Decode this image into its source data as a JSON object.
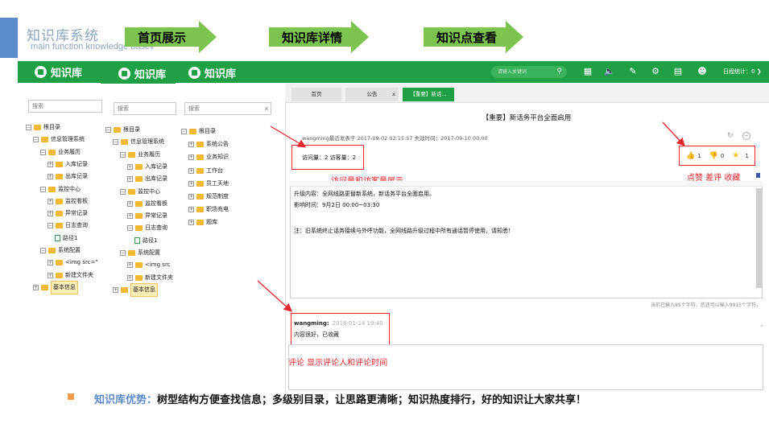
{
  "slide": {
    "title": "知识库系统",
    "subtitle": "main function knowledge basev",
    "steps": [
      "首页展示",
      "知识库详情",
      "知识点查看"
    ]
  },
  "app": {
    "logo_text": "知识库",
    "search_placeholder": "请输入关键词",
    "schedule": "日程统计：0",
    "icons": [
      "grid-icon",
      "speaker-icon",
      "edit-icon",
      "gear-icon",
      "document-icon",
      "user-icon"
    ]
  },
  "trees": [
    {
      "search_placeholder": "搜索",
      "items": [
        {
          "label": "根目录",
          "pm": "−",
          "type": "folder",
          "level": 0
        },
        {
          "label": "信息管理系统",
          "pm": "−",
          "type": "folder",
          "level": 1
        },
        {
          "label": "业务履历",
          "pm": "−",
          "type": "folder",
          "level": 2
        },
        {
          "label": "入库记录",
          "pm": "+",
          "type": "folder",
          "level": 3
        },
        {
          "label": "出库记录",
          "pm": "+",
          "type": "folder",
          "level": 3
        },
        {
          "label": "监控中心",
          "pm": "−",
          "type": "folder",
          "level": 2
        },
        {
          "label": "监控看板",
          "pm": "+",
          "type": "folder",
          "level": 3
        },
        {
          "label": "异常记录",
          "pm": "+",
          "type": "folder",
          "level": 3
        },
        {
          "label": "日志查询",
          "pm": "−",
          "type": "folder",
          "level": 3
        },
        {
          "label": "路径1",
          "pm": "",
          "type": "file",
          "level": 4
        },
        {
          "label": "系统配置",
          "pm": "−",
          "type": "folder",
          "level": 2
        },
        {
          "label": "<img src=\"",
          "pm": "+",
          "type": "folder",
          "level": 3
        },
        {
          "label": "新建文件夹",
          "pm": "+",
          "type": "folder",
          "level": 3
        },
        {
          "label": "基本信息",
          "pm": "+",
          "type": "folder",
          "level": 1,
          "highlight": true
        }
      ]
    },
    {
      "search_placeholder": "搜索",
      "items": [
        {
          "label": "根目录",
          "pm": "−",
          "type": "folder",
          "level": 0
        },
        {
          "label": "信息管理系统",
          "pm": "−",
          "type": "folder",
          "level": 1
        },
        {
          "label": "业务履历",
          "pm": "−",
          "type": "folder",
          "level": 2
        },
        {
          "label": "入库记录",
          "pm": "+",
          "type": "folder",
          "level": 3
        },
        {
          "label": "出库记录",
          "pm": "+",
          "type": "folder",
          "level": 3
        },
        {
          "label": "监控中心",
          "pm": "−",
          "type": "folder",
          "level": 2
        },
        {
          "label": "监控看板",
          "pm": "+",
          "type": "folder",
          "level": 3
        },
        {
          "label": "异常记录",
          "pm": "+",
          "type": "folder",
          "level": 3
        },
        {
          "label": "日志查询",
          "pm": "−",
          "type": "folder",
          "level": 3
        },
        {
          "label": "路径1",
          "pm": "",
          "type": "file",
          "level": 4
        },
        {
          "label": "系统配置",
          "pm": "−",
          "type": "folder",
          "level": 2
        },
        {
          "label": "<img src",
          "pm": "+",
          "type": "folder",
          "level": 3
        },
        {
          "label": "新建文件夹",
          "pm": "+",
          "type": "folder",
          "level": 3
        },
        {
          "label": "基本信息",
          "pm": "+",
          "type": "folder",
          "level": 1,
          "highlight": true
        }
      ]
    },
    {
      "search_placeholder": "搜索",
      "clear": "x",
      "items": [
        {
          "label": "根目录",
          "pm": "−",
          "type": "folder",
          "level": 0
        },
        {
          "label": "系统公告",
          "pm": "+",
          "type": "folder",
          "level": 1
        },
        {
          "label": "业务知识",
          "pm": "+",
          "type": "folder",
          "level": 1
        },
        {
          "label": "工作台",
          "pm": "+",
          "type": "folder",
          "level": 1
        },
        {
          "label": "员工天地",
          "pm": "+",
          "type": "folder",
          "level": 1
        },
        {
          "label": "规范制度",
          "pm": "+",
          "type": "folder",
          "level": 1
        },
        {
          "label": "职场充电",
          "pm": "+",
          "type": "folder",
          "level": 1
        },
        {
          "label": "题库",
          "pm": "+",
          "type": "folder",
          "level": 1
        }
      ]
    }
  ],
  "tabs": [
    {
      "label": "首页",
      "active": false
    },
    {
      "label": "公告",
      "active": false,
      "close": "x"
    },
    {
      "label": "【重要】新话...",
      "active": true
    }
  ],
  "notice": {
    "title": "【重要】新话务平台全面启用",
    "meta": "wangming最近发表于 2017-09-02 02:15:57     失效时间：2017-09-10 00:00",
    "counts": "访问量：2   访客量：2",
    "like_count": "1",
    "dislike_count": "0",
    "fav_count": "1",
    "content": [
      "升级内容：全网线路更替新系统，新话务平台全面启用。",
      "影响时间：9月2日 00:00~03:30",
      "",
      "注：旧系统终止话务接续与外呼功能，全网线路升级过程中所有通话暂停使用，请知悉！"
    ],
    "word_count": "当前已输入85个字符，您还可以输入9915个字符。"
  },
  "annotations": {
    "counts": "访问量和访客量展示",
    "actions": "点赞  差评  收藏",
    "comment": "评论  显示评论人和评论时间"
  },
  "comment": {
    "user": "wangming:",
    "time": "2018-01-14 19:40",
    "text": "内容很好，已收藏"
  },
  "footer": {
    "lead": "知识库优势：",
    "text": "树型结构方便查找信息；多级别目录，让思路更清晰；知识热度排行，好的知识让大家共享！"
  }
}
